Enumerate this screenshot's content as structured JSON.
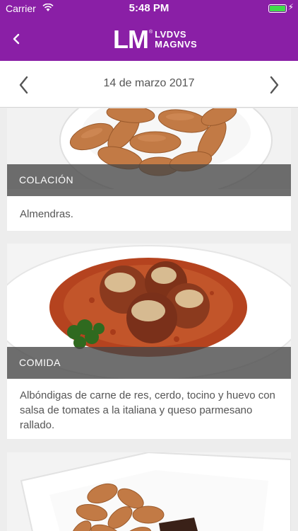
{
  "status": {
    "carrier": "Carrier",
    "time": "5:48 PM"
  },
  "header": {
    "logo_lm": "LM",
    "logo_line1": "LVDVS",
    "logo_line2": "MAGNVS",
    "logo_mark": "®"
  },
  "date": "14 de marzo 2017",
  "meals": [
    {
      "label": "COLACIÓN",
      "description": "Almendras."
    },
    {
      "label": "COMIDA",
      "description": "Albóndigas de carne de res, cerdo, tocino y huevo con salsa de tomates a la italiana y queso parmesano rallado."
    }
  ]
}
